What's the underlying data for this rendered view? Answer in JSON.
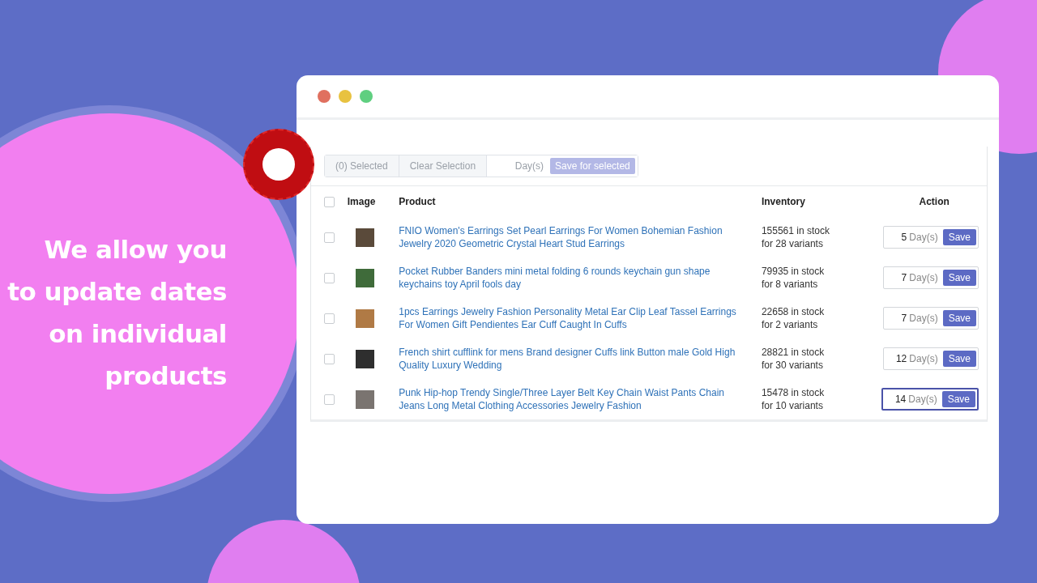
{
  "headline": "We allow you\nto update dates\non individual\nproducts",
  "toolbar": {
    "selected_count": "(0) Selected",
    "clear_button": "Clear Selection",
    "days_placeholder": "Day(s)",
    "save_selected_button": "Save for selected",
    "save_selected_disabled": true
  },
  "table": {
    "select_all_checked": false,
    "columns": [
      "Image",
      "Product",
      "Inventory",
      "Action"
    ],
    "rows": [
      {
        "checked": false,
        "product": "FNIO Women's Earrings Set Pearl Earrings For Women Bohemian Fashion Jewelry 2020 Geometric Crystal Heart Stud Earrings",
        "stock": "155561 in stock",
        "variants": "for 28 variants",
        "days": "5",
        "unit": "Day(s)",
        "focused": false,
        "save": "Save"
      },
      {
        "checked": false,
        "product": "Pocket Rubber Banders mini metal folding 6 rounds keychain gun shape keychains toy April fools day",
        "stock": "79935 in stock",
        "variants": "for 8 variants",
        "days": "7",
        "unit": "Day(s)",
        "focused": false,
        "save": "Save"
      },
      {
        "checked": false,
        "product": "1pcs Earrings Jewelry Fashion Personality Metal Ear Clip Leaf Tassel Earrings For Women Gift Pendientes Ear Cuff Caught In Cuffs",
        "stock": "22658 in stock",
        "variants": "for 2 variants",
        "days": "7",
        "unit": "Day(s)",
        "focused": false,
        "save": "Save"
      },
      {
        "checked": false,
        "product": "French shirt cufflink for mens Brand designer Cuffs link Button male Gold High Quality Luxury Wedding",
        "stock": "28821 in stock",
        "variants": "for 30 variants",
        "days": "12",
        "unit": "Day(s)",
        "focused": false,
        "save": "Save"
      },
      {
        "checked": false,
        "product": "Punk Hip-hop Trendy Single/Three Layer Belt Key Chain Waist Pants Chain Jeans Long Metal Clothing Accessories Jewelry Fashion",
        "stock": "15478 in stock",
        "variants": "for 10 variants",
        "days": "14",
        "unit": "Day(s)",
        "focused": true,
        "save": "Save"
      }
    ]
  }
}
